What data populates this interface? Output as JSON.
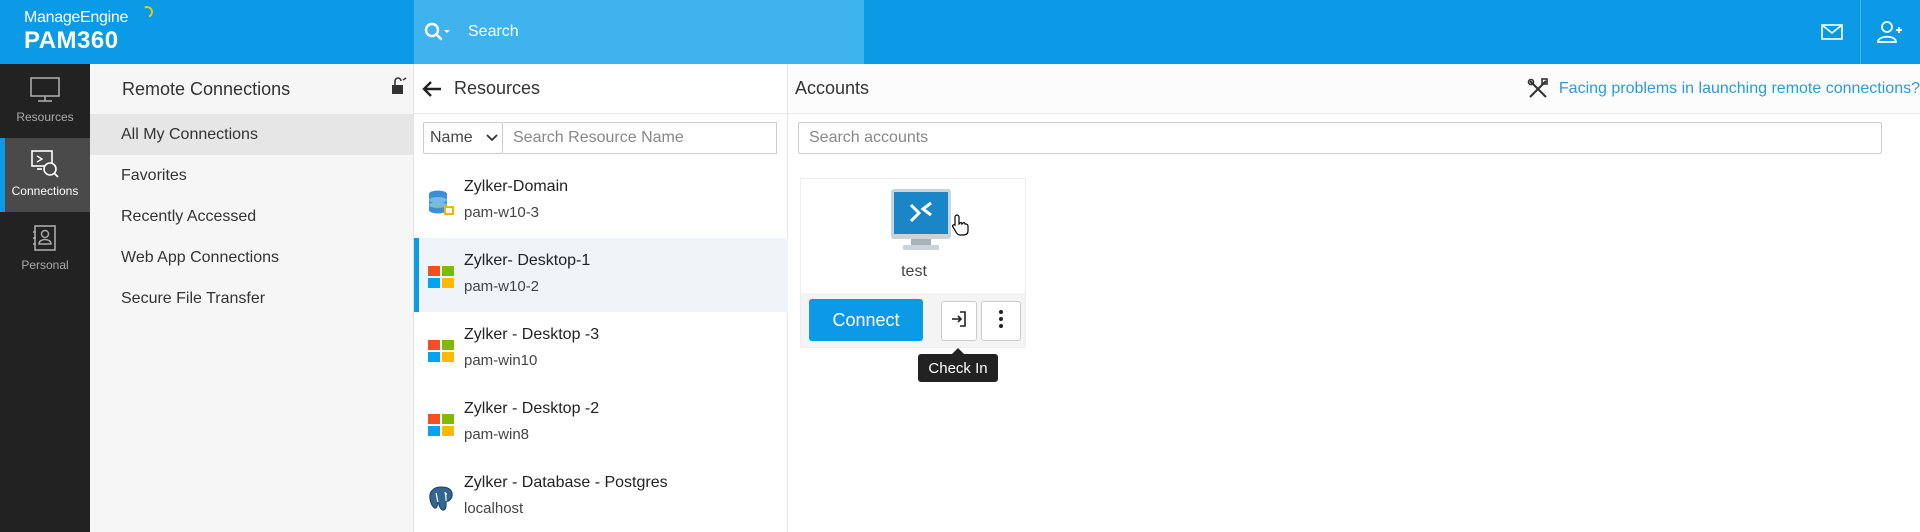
{
  "header": {
    "brand": "ManageEngine",
    "product": "PAM360",
    "search_placeholder": "Search"
  },
  "leftnav": {
    "items": [
      {
        "label": "Resources",
        "icon": "monitor-icon"
      },
      {
        "label": "Connections",
        "icon": "connections-icon",
        "active": true
      },
      {
        "label": "Personal",
        "icon": "personal-icon"
      }
    ]
  },
  "remote_connections": {
    "title": "Remote Connections",
    "items": [
      {
        "label": "All My Connections",
        "active": true
      },
      {
        "label": "Favorites"
      },
      {
        "label": "Recently Accessed"
      },
      {
        "label": "Web App Connections"
      },
      {
        "label": "Secure File Transfer"
      }
    ]
  },
  "resources": {
    "title": "Resources",
    "filter_select": "Name",
    "search_placeholder": "Search Resource Name",
    "items": [
      {
        "name": "Zylker-Domain",
        "sub": "pam-w10-3",
        "icon": "database-icon"
      },
      {
        "name": "Zylker- Desktop-1",
        "sub": "pam-w10-2",
        "icon": "windows-icon",
        "active": true
      },
      {
        "name": "Zylker - Desktop -3",
        "sub": "pam-win10",
        "icon": "windows-icon"
      },
      {
        "name": "Zylker - Desktop -2",
        "sub": "pam-win8",
        "icon": "windows-icon"
      },
      {
        "name": "Zylker - Database - Postgres",
        "sub": "localhost",
        "icon": "postgres-icon"
      }
    ]
  },
  "accounts": {
    "title": "Accounts",
    "help_link": "Facing problems in launching remote connections?",
    "search_placeholder": "Search accounts",
    "cards": [
      {
        "name": "test",
        "connect_label": "Connect",
        "tooltip": "Check In"
      }
    ]
  },
  "colors": {
    "primary": "#0a9ae6",
    "nav_bg": "#222222",
    "link": "#2b9ae0"
  }
}
